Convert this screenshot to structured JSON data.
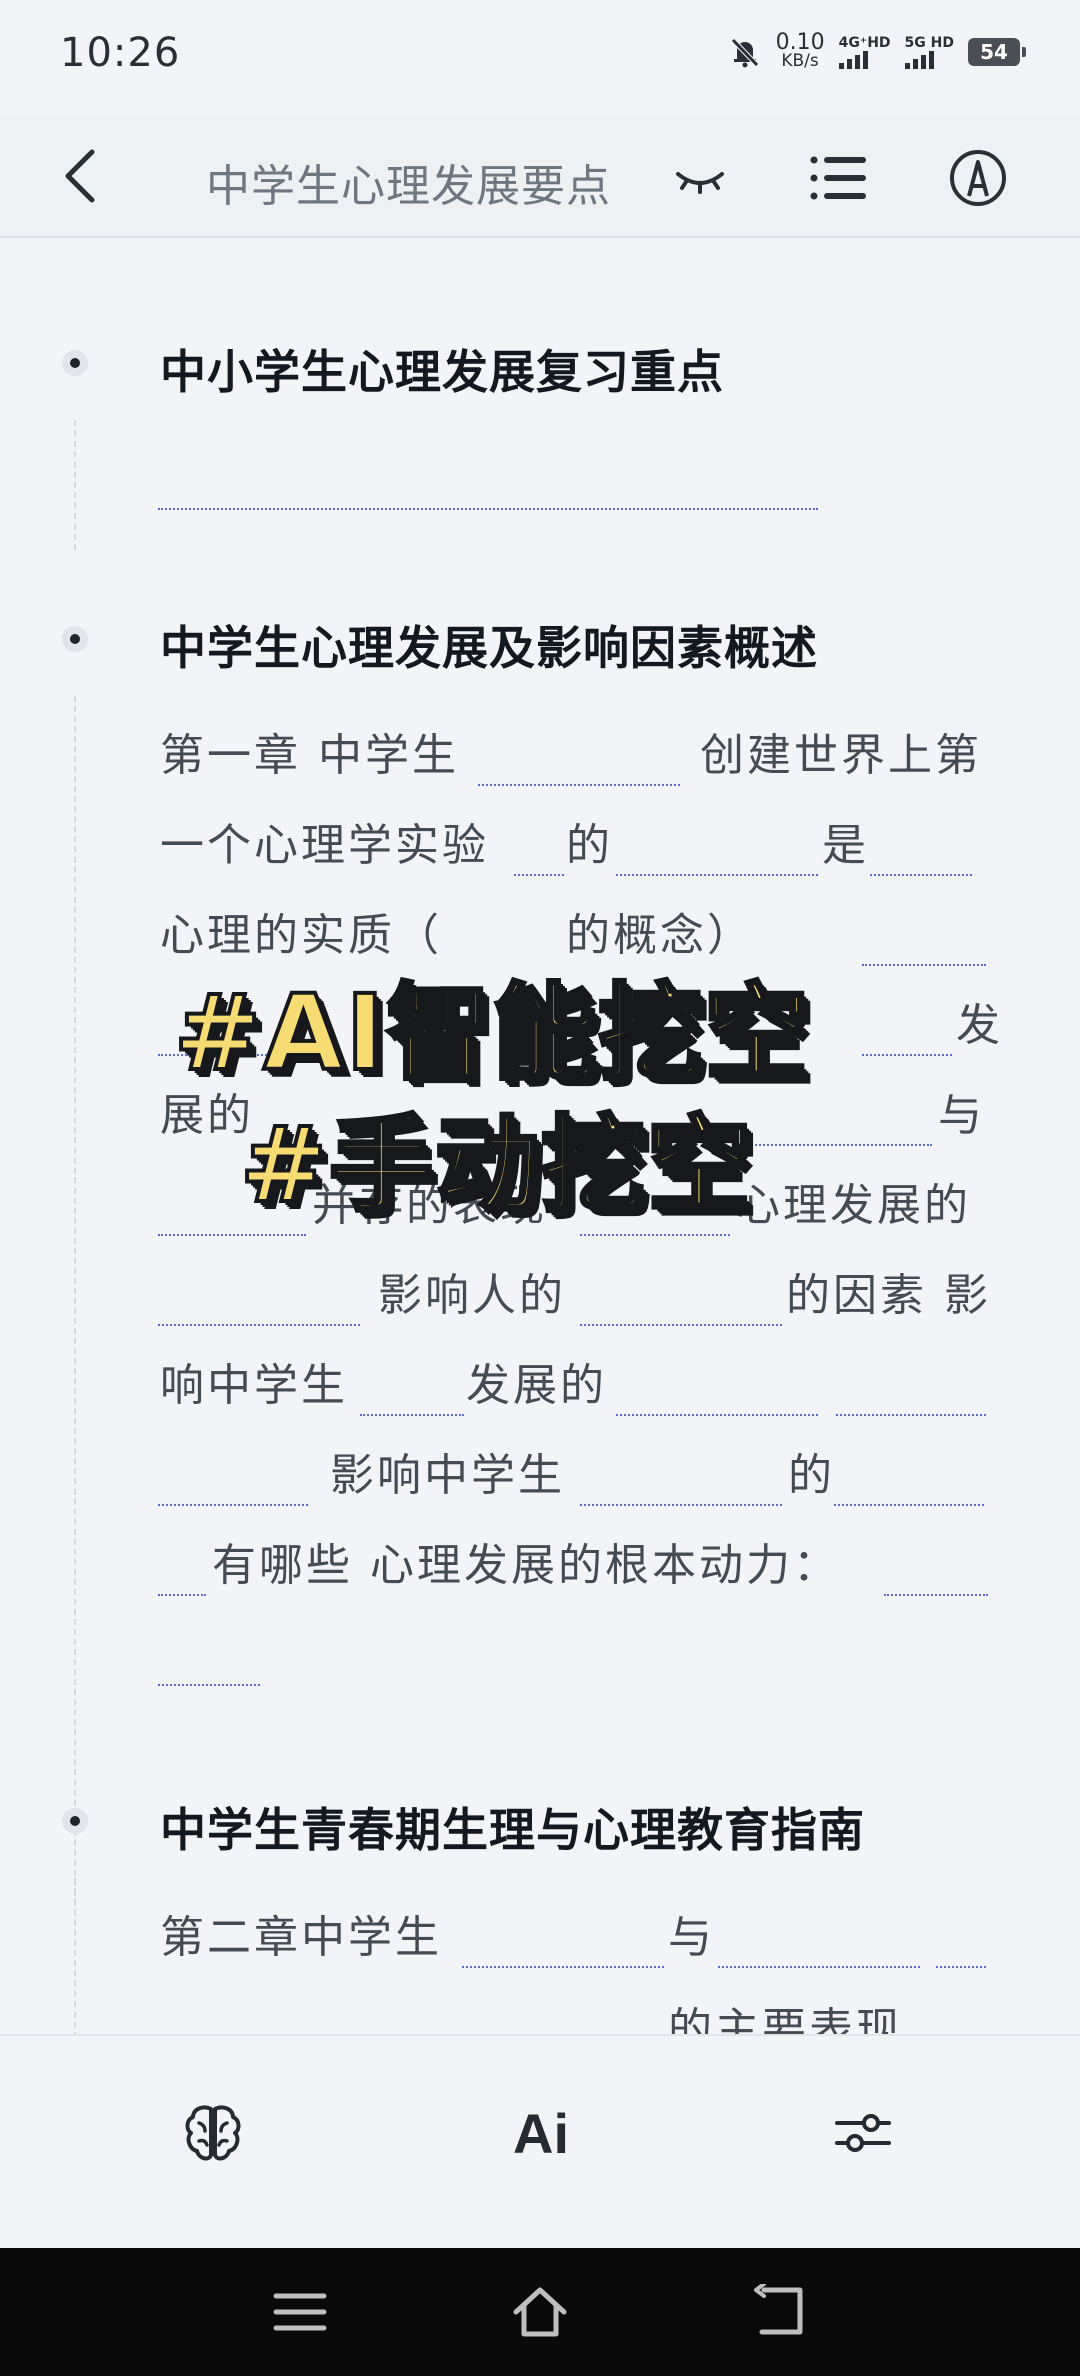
{
  "status_bar": {
    "time": "10:26",
    "speed_value": "0.10",
    "speed_unit": "KB/s",
    "net1": "4G⁺HD",
    "net2": "5G HD",
    "battery": "54"
  },
  "app_bar": {
    "title": "中学生心理发展要点"
  },
  "sections": [
    {
      "heading": "中小学生心理发展复习重点"
    },
    {
      "heading": "中学生心理发展及影响因素概述",
      "lines": [
        [
          "第一章 中学生",
          "创建世界上第"
        ],
        [
          "一个心理学实验",
          "的",
          "是"
        ],
        [
          "心理的实质（",
          "的概念）"
        ],
        [
          "发"
        ],
        [
          "展的",
          "与"
        ],
        [
          "并存的表现",
          "心理发展的"
        ],
        [
          "影响人的",
          "的因素 影"
        ],
        [
          "响中学生",
          "发展的"
        ],
        [
          "影响中学生",
          "的"
        ],
        [
          "有哪些 心理发展的根本动力："
        ]
      ]
    },
    {
      "heading": "中学生青春期生理与心理教育指南",
      "lines": [
        [
          "第二章中学生",
          "与"
        ],
        [
          "的主要表现"
        ]
      ]
    }
  ],
  "overlay": {
    "line1": "#AI智能挖空",
    "line2": "#手动挖空"
  },
  "toolbar": {
    "ai_label": "Ai"
  },
  "colors": {
    "background": "#f2f4f7",
    "blank_underline": "#5d6fd6",
    "stamp_fill": "#f7dc74",
    "nav_bar": "#0a0a0a"
  },
  "icons": [
    "back-arrow-icon",
    "eye-closed-icon",
    "list-icon",
    "pen-circle-icon",
    "brain-icon",
    "ai-sparkle-icon",
    "sliders-icon",
    "menu-nav-icon",
    "home-nav-icon",
    "back-nav-icon"
  ]
}
